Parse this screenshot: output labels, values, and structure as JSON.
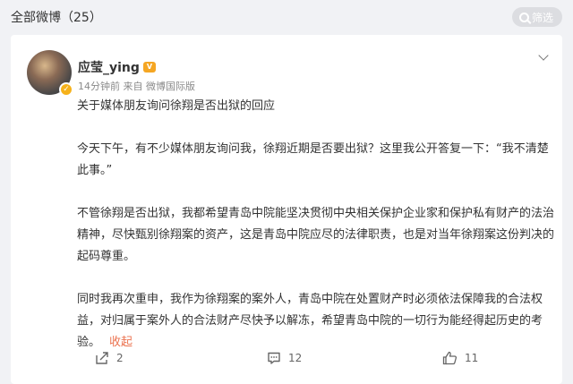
{
  "header": {
    "title": "全部微博（25）",
    "filter_label": "筛选"
  },
  "post": {
    "username": "应莹_ying",
    "meta": "14分钟前  来自 微博国际版",
    "paragraphs": [
      "关于媒体朋友询问徐翔是否出狱的回应",
      "今天下午，有不少媒体朋友询问我，徐翔近期是否要出狱？这里我公开答复一下：“我不清楚此事。”",
      "不管徐翔是否出狱，我都希望青岛中院能坚决贯彻中央相关保护企业家和保护私有财产的法治精神，尽快甄别徐翔案的资产，这是青岛中院应尽的法律职责，也是对当年徐翔案这份判决的起码尊重。",
      "同时我再次重申，我作为徐翔案的案外人，青岛中院在处置财产时必须依法保障我的合法权益，对归属于案外人的合法财产尽快予以解冻，希望青岛中院的一切行为能经得起历史的考验。"
    ],
    "collapse_label": "收起"
  },
  "actions": {
    "repost_count": "2",
    "comment_count": "12",
    "like_count": "11"
  },
  "colors": {
    "accent": "#eb7350",
    "background": "#f1f2f5"
  },
  "icons": [
    "search-icon",
    "chevron-down-icon",
    "repost-icon",
    "comment-icon",
    "like-icon",
    "verified-icon"
  ]
}
